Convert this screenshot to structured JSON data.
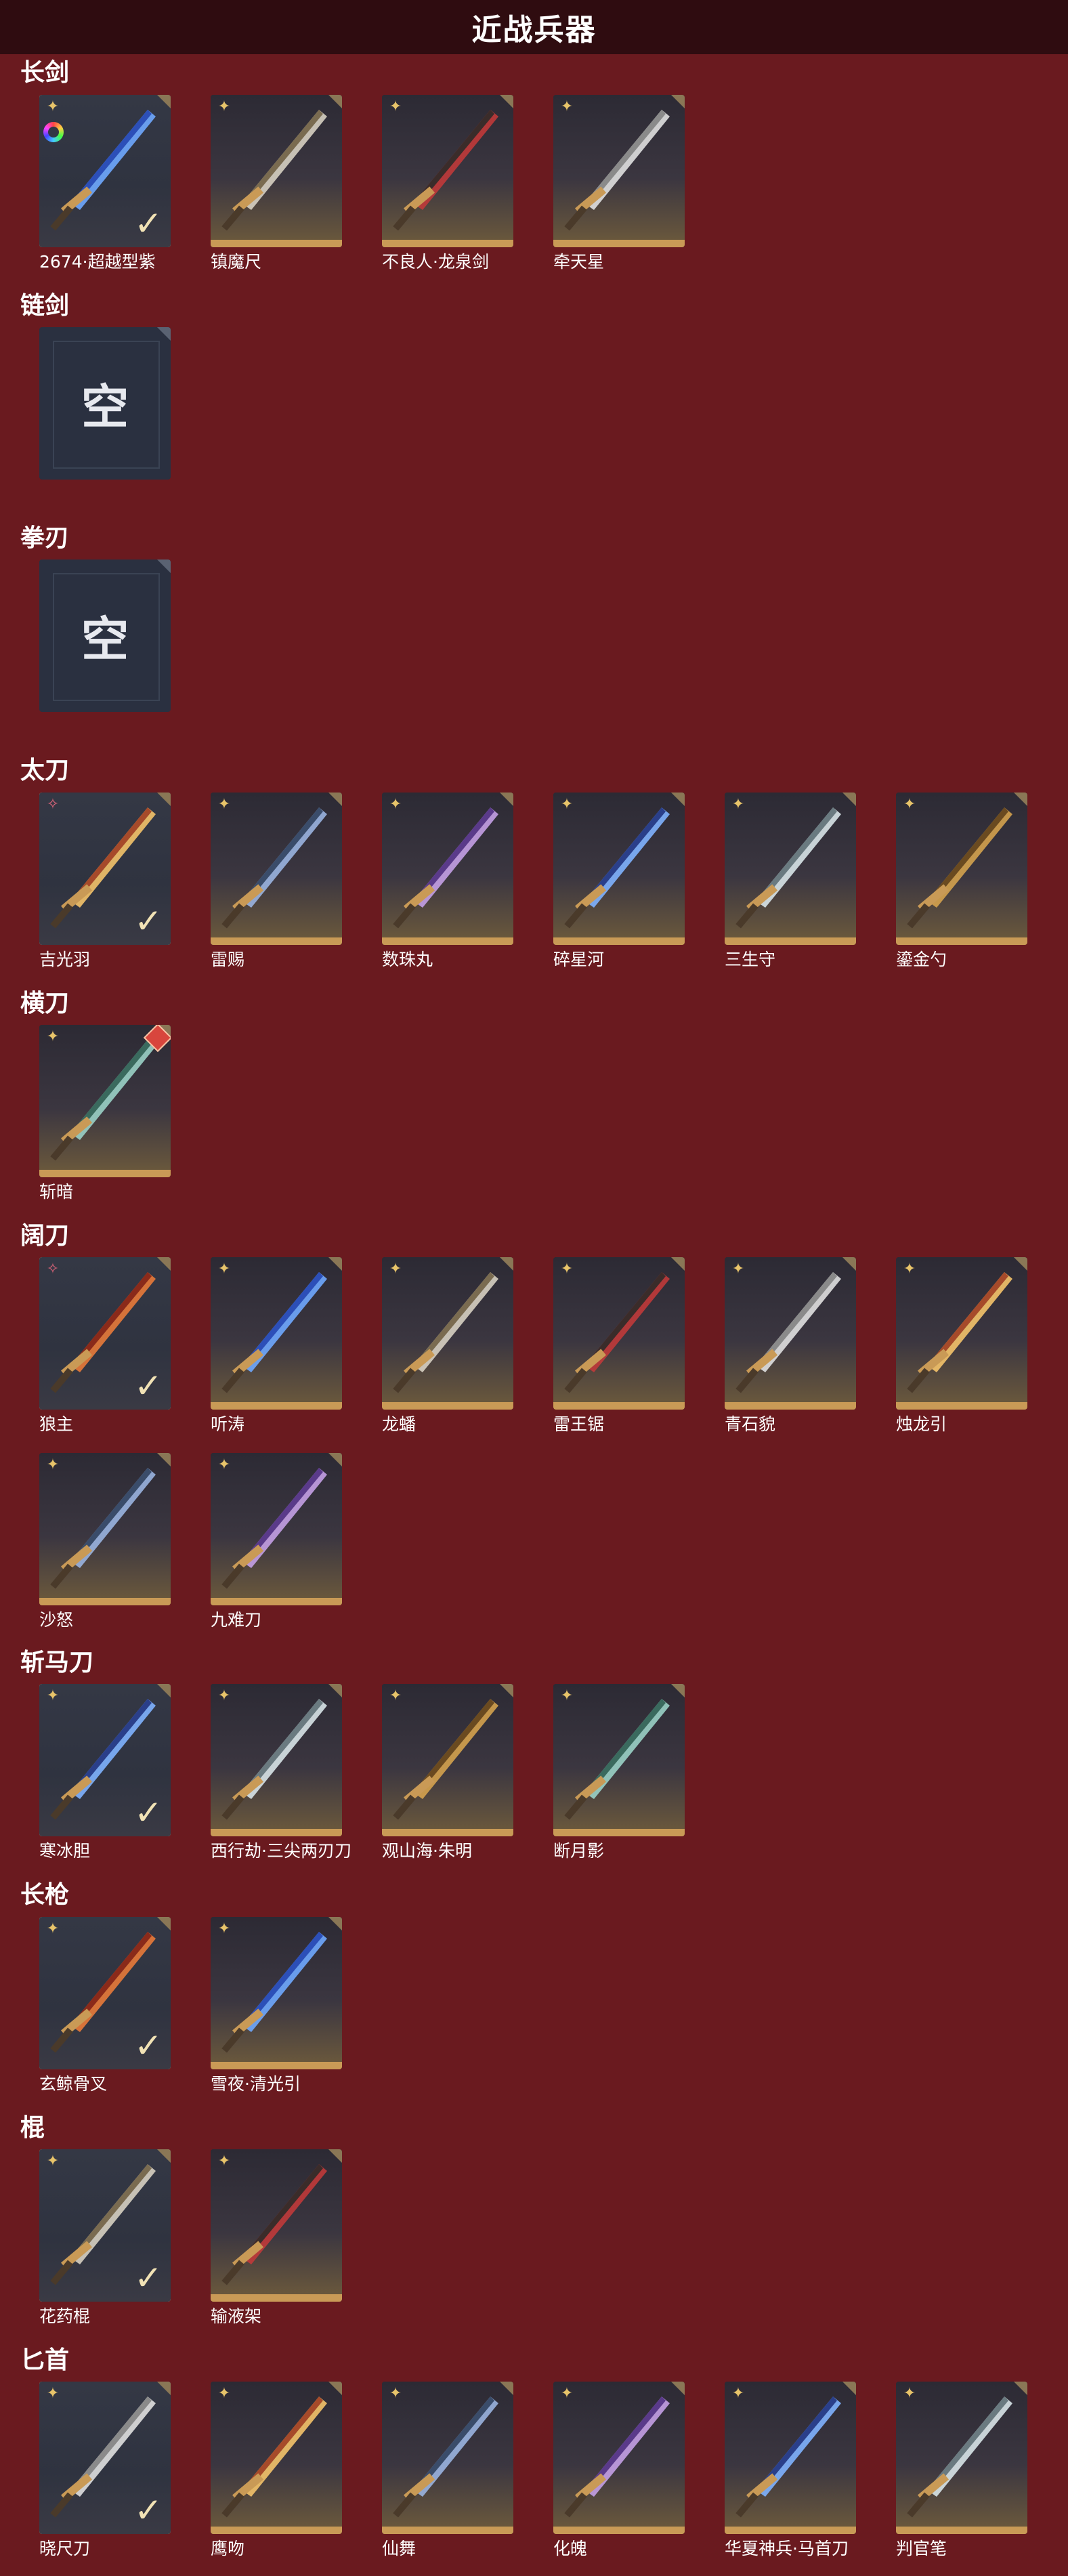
{
  "header": {
    "title": "近战兵器"
  },
  "categories": [
    {
      "name": "长剑",
      "items": [
        {
          "name": "2674·超越型紫",
          "selected": true,
          "rarity": "gold",
          "icon": "blade-blue-icon"
        },
        {
          "name": "镇魔尺",
          "selected": false,
          "rarity": "gold",
          "icon": "sword-icon"
        },
        {
          "name": "不良人·龙泉剑",
          "selected": false,
          "rarity": "gold",
          "icon": "sword-icon"
        },
        {
          "name": "牵天星",
          "selected": false,
          "rarity": "gold",
          "icon": "sword-icon"
        }
      ]
    },
    {
      "name": "链剑",
      "items": [],
      "empty_label": "空"
    },
    {
      "name": "拳刃",
      "items": [],
      "empty_label": "空"
    },
    {
      "name": "太刀",
      "items": [
        {
          "name": "吉光羽",
          "selected": true,
          "rarity": "red",
          "icon": "katana-flame-icon"
        },
        {
          "name": "雷赐",
          "selected": false,
          "rarity": "gold",
          "icon": "katana-icon"
        },
        {
          "name": "数珠丸",
          "selected": false,
          "rarity": "gold",
          "icon": "katana-icon"
        },
        {
          "name": "碎星河",
          "selected": false,
          "rarity": "gold",
          "icon": "katana-icon"
        },
        {
          "name": "三生守",
          "selected": false,
          "rarity": "gold",
          "icon": "katana-icon"
        },
        {
          "name": "鎏金勺",
          "selected": false,
          "rarity": "gold",
          "icon": "spoon-icon"
        }
      ]
    },
    {
      "name": "横刀",
      "items": [
        {
          "name": "斩暗",
          "selected": false,
          "rarity": "gold",
          "icon": "sabre-icon",
          "badge": true
        }
      ]
    },
    {
      "name": "阔刀",
      "items": [
        {
          "name": "狼主",
          "selected": true,
          "rarity": "red",
          "icon": "broadsword-icon"
        },
        {
          "name": "听涛",
          "selected": false,
          "rarity": "gold",
          "icon": "broadsword-icon"
        },
        {
          "name": "龙蟠",
          "selected": false,
          "rarity": "gold",
          "icon": "broadsword-icon"
        },
        {
          "name": "雷王锯",
          "selected": false,
          "rarity": "gold",
          "icon": "broadsword-icon"
        },
        {
          "name": "青石貌",
          "selected": false,
          "rarity": "gold",
          "icon": "broadsword-icon"
        },
        {
          "name": "烛龙引",
          "selected": false,
          "rarity": "gold",
          "icon": "broadsword-icon"
        },
        {
          "name": "沙怒",
          "selected": false,
          "rarity": "gold",
          "icon": "broadsword-icon"
        },
        {
          "name": "九难刀",
          "selected": false,
          "rarity": "gold",
          "icon": "broadsword-icon"
        }
      ]
    },
    {
      "name": "斩马刀",
      "items": [
        {
          "name": "寒冰胆",
          "selected": true,
          "rarity": "gold",
          "icon": "ice-blade-icon"
        },
        {
          "name": "西行劫·三尖两刃刀",
          "selected": false,
          "rarity": "gold",
          "icon": "glaive-icon"
        },
        {
          "name": "观山海·朱明",
          "selected": false,
          "rarity": "gold",
          "icon": "glaive-icon"
        },
        {
          "name": "断月影",
          "selected": false,
          "rarity": "gold",
          "icon": "glaive-icon"
        }
      ]
    },
    {
      "name": "长枪",
      "items": [
        {
          "name": "玄鲸骨叉",
          "selected": true,
          "rarity": "gold",
          "icon": "trident-icon"
        },
        {
          "name": "雪夜·清光引",
          "selected": false,
          "rarity": "gold",
          "icon": "spear-icon"
        }
      ]
    },
    {
      "name": "棍",
      "items": [
        {
          "name": "花药棍",
          "selected": true,
          "rarity": "gold",
          "icon": "staff-icon"
        },
        {
          "name": "输液架",
          "selected": false,
          "rarity": "gold",
          "icon": "iv-stand-icon"
        }
      ]
    },
    {
      "name": "匕首",
      "items": [
        {
          "name": "晓尺刀",
          "selected": true,
          "rarity": "gold",
          "icon": "dagger-icon"
        },
        {
          "name": "鹰吻",
          "selected": false,
          "rarity": "gold",
          "icon": "dagger-icon"
        },
        {
          "name": "仙舞",
          "selected": false,
          "rarity": "gold",
          "icon": "dagger-icon"
        },
        {
          "name": "化魄",
          "selected": false,
          "rarity": "gold",
          "icon": "dagger-icon"
        },
        {
          "name": "华夏神兵·马首刀",
          "selected": false,
          "rarity": "gold",
          "icon": "dagger-icon"
        },
        {
          "name": "判官笔",
          "selected": false,
          "rarity": "gold",
          "icon": "brush-icon"
        }
      ]
    }
  ],
  "colors": {
    "background": "#6a1a1f",
    "header": "#2f0c10",
    "gold": "#c99a56",
    "selected_border": "#f1e2b5"
  }
}
